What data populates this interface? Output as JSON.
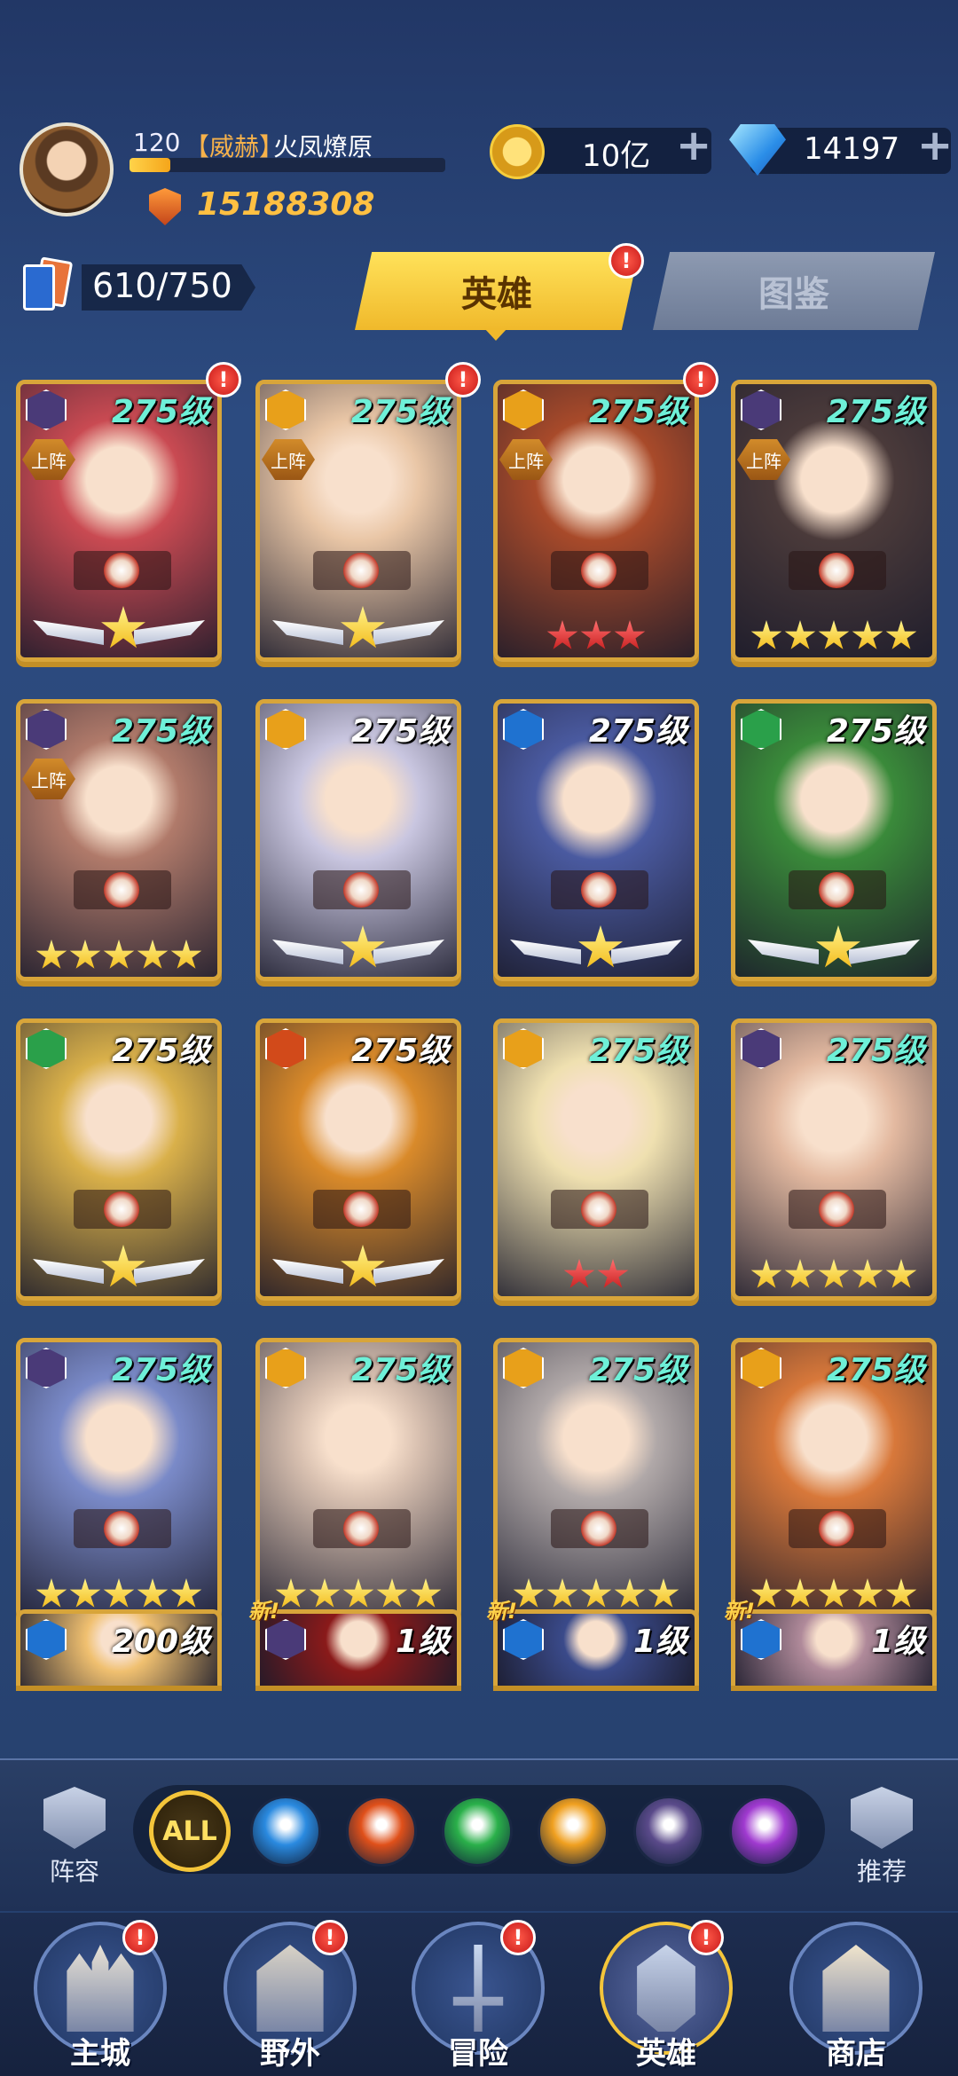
{
  "player": {
    "level": "120",
    "title_tag": "【威赫】",
    "name": "火凤燎原",
    "xp_fraction": 0.13,
    "power": "15188308"
  },
  "currency": {
    "gold": "10亿",
    "gems": "14197",
    "plus": "+"
  },
  "roster": {
    "count": "610/750"
  },
  "tabs": [
    {
      "label": "英雄",
      "active": true,
      "badge": "!"
    },
    {
      "label": "图鉴",
      "active": false
    }
  ],
  "labels": {
    "on_team": "上阵",
    "new": "新!",
    "badge": "!"
  },
  "heroes": [
    {
      "level": "275级",
      "faction": "dark",
      "on_team": true,
      "badge": true,
      "stars": "1w",
      "color": "#c94a52"
    },
    {
      "level": "275级",
      "faction": "light",
      "on_team": true,
      "badge": true,
      "stars": "1w",
      "color": "#e9c6a6"
    },
    {
      "level": "275级",
      "faction": "light",
      "on_team": true,
      "badge": true,
      "stars": "3r",
      "color": "#a84a2a"
    },
    {
      "level": "275级",
      "faction": "dark",
      "on_team": true,
      "badge": false,
      "stars": "5y",
      "color": "#4a3a3a"
    },
    {
      "level": "275级",
      "faction": "dark",
      "on_team": true,
      "badge": false,
      "stars": "5y",
      "color": "#b07a6a"
    },
    {
      "level": "275级",
      "faction": "light",
      "on_team": false,
      "badge": false,
      "stars": "1w",
      "color": "#c9c6e0"
    },
    {
      "level": "275级",
      "faction": "water",
      "on_team": false,
      "badge": false,
      "stars": "1w",
      "color": "#4a5aa0"
    },
    {
      "level": "275级",
      "faction": "wind",
      "on_team": false,
      "badge": false,
      "stars": "1w",
      "color": "#3a8a3a"
    },
    {
      "level": "275级",
      "faction": "wind",
      "on_team": false,
      "badge": false,
      "stars": "1w",
      "color": "#d9b04a"
    },
    {
      "level": "275级",
      "faction": "fire",
      "on_team": false,
      "badge": false,
      "stars": "1w",
      "color": "#d98a2a"
    },
    {
      "level": "275级",
      "faction": "light",
      "on_team": false,
      "badge": false,
      "stars": "2r",
      "color": "#efe0b0"
    },
    {
      "level": "275级",
      "faction": "dark",
      "on_team": false,
      "badge": false,
      "stars": "5y",
      "color": "#e3b9a0"
    },
    {
      "level": "275级",
      "faction": "dark",
      "on_team": false,
      "badge": false,
      "stars": "5y",
      "color": "#7a8ac8"
    },
    {
      "level": "275级",
      "faction": "light",
      "on_team": false,
      "badge": false,
      "stars": "5y",
      "color": "#d8c0b0"
    },
    {
      "level": "275级",
      "faction": "light",
      "on_team": false,
      "badge": false,
      "stars": "5y",
      "color": "#b0a8a8"
    },
    {
      "level": "275级",
      "faction": "light",
      "on_team": false,
      "badge": false,
      "stars": "5y",
      "color": "#d8783a"
    },
    {
      "level": "200级",
      "faction": "water",
      "on_team": false,
      "badge": false,
      "stars": "",
      "color": "#f0c070"
    },
    {
      "level": "1级",
      "faction": "dark",
      "on_team": false,
      "badge": false,
      "stars": "",
      "color": "#8a1a1a",
      "new": true
    },
    {
      "level": "1级",
      "faction": "water",
      "on_team": false,
      "badge": false,
      "stars": "",
      "color": "#3a4a8a",
      "new": true
    },
    {
      "level": "1级",
      "faction": "water",
      "on_team": false,
      "badge": false,
      "stars": "",
      "color": "#b08a9a",
      "new": true
    }
  ],
  "filters": {
    "left": {
      "label": "阵容",
      "icon": "shield-icon"
    },
    "right": {
      "label": "推荐",
      "icon": "thumbs-up-icon"
    },
    "items": [
      {
        "label": "ALL",
        "icon": "all-icon",
        "active": true
      },
      {
        "icon": "water-faction-icon",
        "color": "#2a8ae0"
      },
      {
        "icon": "fire-faction-icon",
        "color": "#e0501a"
      },
      {
        "icon": "wind-faction-icon",
        "color": "#2ab04a"
      },
      {
        "icon": "light-faction-icon",
        "color": "#f0a020"
      },
      {
        "icon": "dark-faction-icon",
        "color": "#5a4a8a"
      },
      {
        "icon": "arcane-faction-icon",
        "color": "#a03ad0"
      }
    ]
  },
  "nav": [
    {
      "label": "主城",
      "icon": "castle-icon",
      "badge": true
    },
    {
      "label": "野外",
      "icon": "portal-icon",
      "badge": true
    },
    {
      "label": "冒险",
      "icon": "sword-icon",
      "badge": true
    },
    {
      "label": "英雄",
      "icon": "knight-helmet-icon",
      "badge": true,
      "active": true
    },
    {
      "label": "商店",
      "icon": "shop-icon",
      "badge": false
    }
  ],
  "colors": {
    "faction": {
      "dark": "#4a3a78",
      "light": "#e8a01a",
      "water": "#1f72d0",
      "wind": "#2aa04a",
      "fire": "#d24a1a"
    }
  }
}
